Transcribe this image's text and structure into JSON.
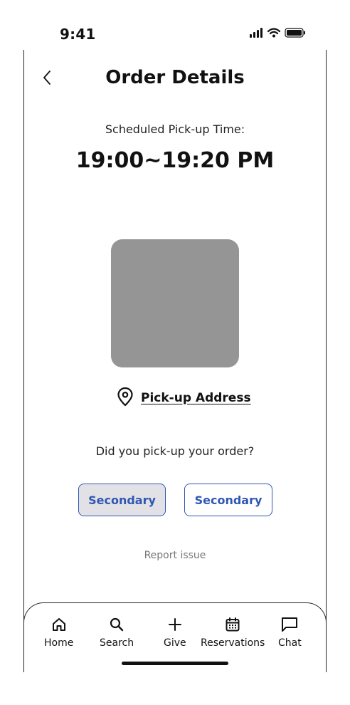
{
  "status_bar": {
    "time": "9:41"
  },
  "header": {
    "title": "Order Details"
  },
  "pickup": {
    "label": "Scheduled Pick-up Time:",
    "time": "19:00~19:20 PM"
  },
  "address": {
    "label": "Pick-up Address"
  },
  "confirm": {
    "question": "Did you pick-up your order?",
    "button_a": "Secondary",
    "button_b": "Secondary"
  },
  "report": {
    "label": "Report issue"
  },
  "tabbar": {
    "items": [
      {
        "label": "Home",
        "icon": "home-icon"
      },
      {
        "label": "Search",
        "icon": "search-icon"
      },
      {
        "label": "Give",
        "icon": "plus-icon"
      },
      {
        "label": "Reservations",
        "icon": "calendar-icon"
      },
      {
        "label": "Chat",
        "icon": "chat-icon"
      }
    ]
  },
  "colors": {
    "accent": "#2f57b3",
    "placeholder": "#959595",
    "button_fill": "#e2e2e6"
  }
}
